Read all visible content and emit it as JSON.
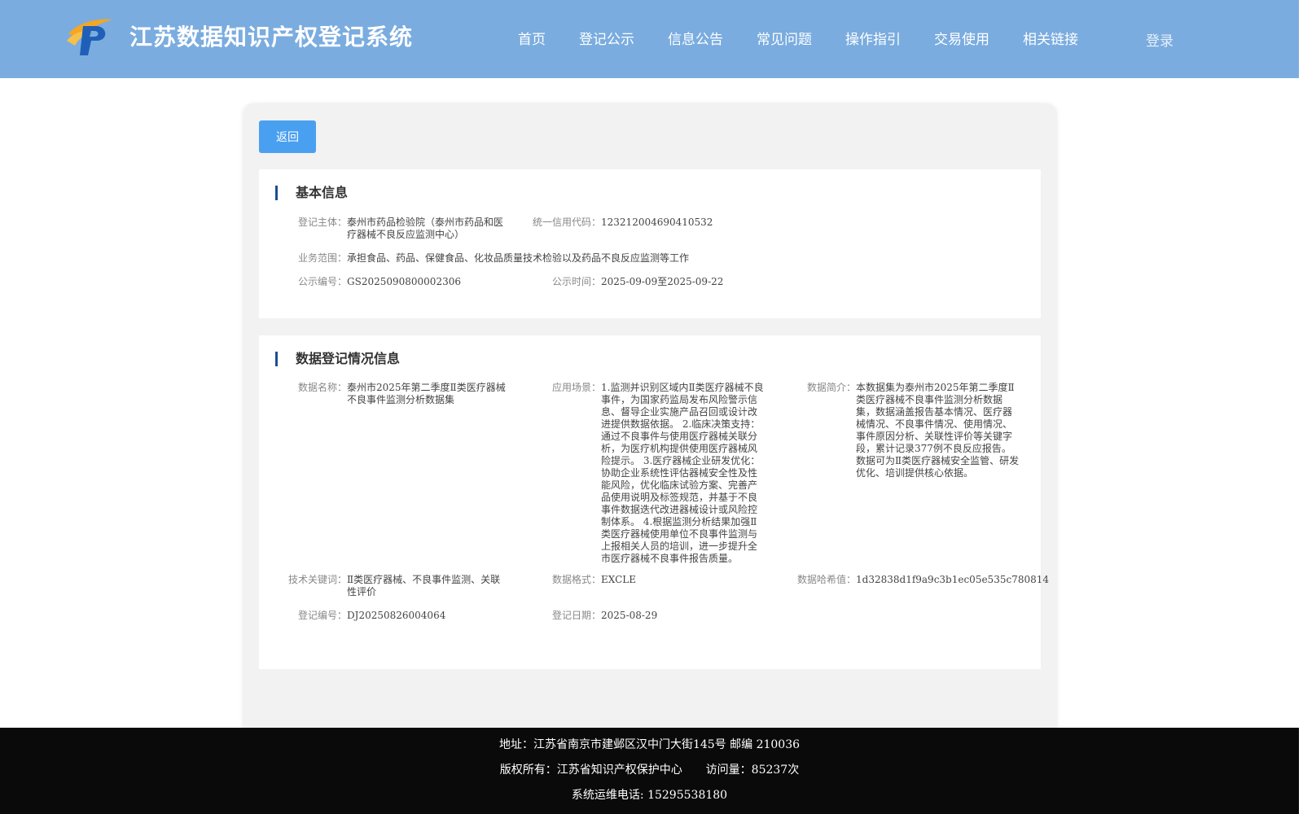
{
  "header": {
    "site_title": "江苏数据知识产权登记系统",
    "logo_icon": "jiangsu-ip-logo-icon",
    "nav": [
      "首页",
      "登记公示",
      "信息公告",
      "常见问题",
      "操作指引",
      "交易使用",
      "相关链接"
    ],
    "login": "登录",
    "bg_color": "#7aacdf"
  },
  "toolbar": {
    "back_label": "返回"
  },
  "basic_info": {
    "title": "基本信息",
    "registrant_label": "登记主体：",
    "registrant_value": "泰州市药品检验院（泰州市药品和医疗器械不良反应监测中心）",
    "credit_code_label": "统一信用代码：",
    "credit_code_value": "123212004690410532",
    "scope_label": "业务范围：",
    "scope_value": "承担食品、药品、保健食品、化妆品质量技术检验以及药品不良反应监测等工作",
    "notice_no_label": "公示编号：",
    "notice_no_value": "GS2025090800002306",
    "notice_time_label": "公示时间：",
    "notice_time_value": "2025-09-09至2025-09-22"
  },
  "registration_info": {
    "title": "数据登记情况信息",
    "data_name_label": "数据名称：",
    "data_name_value": "泰州市2025年第二季度Ⅱ类医疗器械不良事件监测分析数据集",
    "scenario_label": "应用场景：",
    "scenario_value": "1.监测并识别区域内Ⅱ类医疗器械不良事件，为国家药监局发布风险警示信息、督导企业实施产品召回或设计改进提供数据依据。 2.临床决策支持：通过不良事件与使用医疗器械关联分析，为医疗机构提供使用医疗器械风险提示。 3.医疗器械企业研发优化：协助企业系统性评估器械安全性及性能风险，优化临床试验方案、完善产品使用说明及标签规范，并基于不良事件数据迭代改进器械设计或风险控制体系。 4.根据监测分析结果加强Ⅱ类医疗器械使用单位不良事件监测与上报相关人员的培训，进一步提升全市医疗器械不良事件报告质量。",
    "summary_label": "数据简介：",
    "summary_value": "本数据集为泰州市2025年第二季度Ⅱ类医疗器械不良事件监测分析数据集，数据涵盖报告基本情况、医疗器械情况、不良事件情况、使用情况、事件原因分析、关联性评价等关键字段，累计记录377例不良反应报告。数据可为Ⅱ类医疗器械安全监管、研发优化、培训提供核心依据。",
    "keywords_label": "技术关键词：",
    "keywords_value": "Ⅱ类医疗器械、不良事件监测、关联性评价",
    "format_label": "数据格式：",
    "format_value": "EXCLE",
    "hash_label": "数据哈希值：",
    "hash_value": "1d32838d1f9a9c3b1ec05e535c780814",
    "reg_no_label": "登记编号：",
    "reg_no_value": "DJ20250826004064",
    "reg_date_label": "登记日期：",
    "reg_date_value": "2025-08-29"
  },
  "footer": {
    "address": "地址：江苏省南京市建邺区汉中门大街145号 邮编 210036",
    "copyright": "版权所有：江苏省知识产权保护中心",
    "visits": "访问量：85237次",
    "phone": "系统运维电话: 15295538180"
  }
}
